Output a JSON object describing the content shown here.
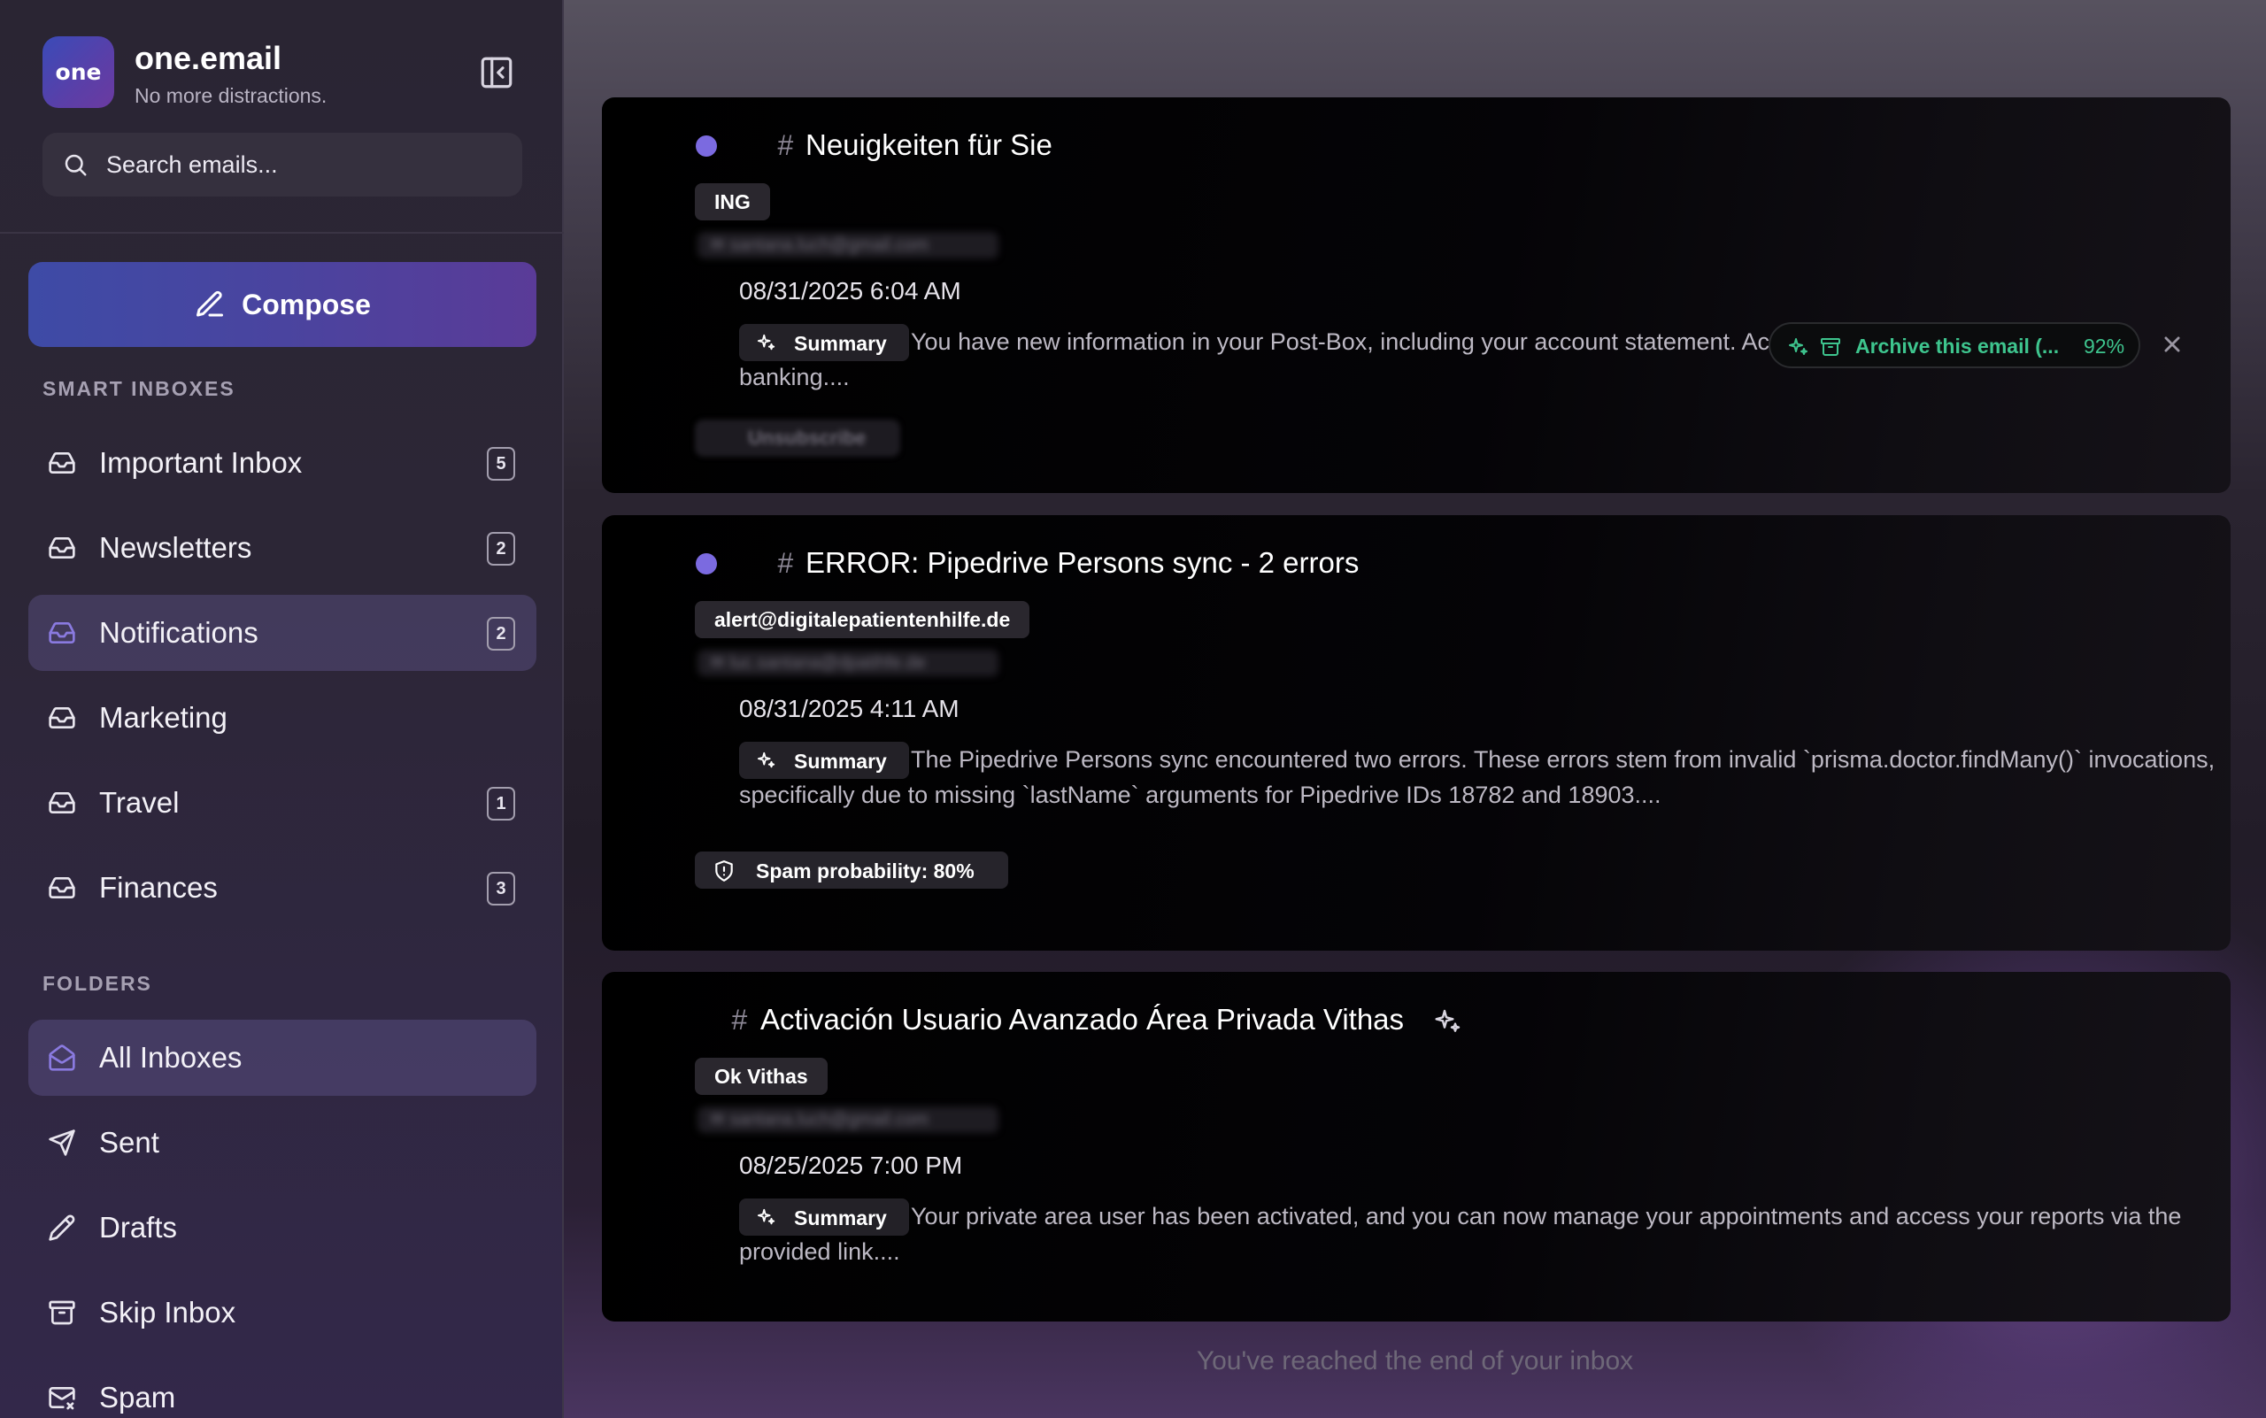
{
  "app": {
    "name": "one.email",
    "tagline": "No more distractions.",
    "logo_text": "one"
  },
  "search": {
    "placeholder": "Search emails..."
  },
  "compose": {
    "label": "Compose"
  },
  "smart_inboxes": {
    "heading": "SMART INBOXES",
    "items": [
      {
        "label": "Important Inbox",
        "count": "5",
        "icon": "inbox-icon"
      },
      {
        "label": "Newsletters",
        "count": "2",
        "icon": "inbox-icon"
      },
      {
        "label": "Notifications",
        "count": "2",
        "icon": "inbox-icon",
        "active": true
      },
      {
        "label": "Marketing",
        "count": "",
        "icon": "inbox-icon"
      },
      {
        "label": "Travel",
        "count": "1",
        "icon": "inbox-icon"
      },
      {
        "label": "Finances",
        "count": "3",
        "icon": "inbox-icon"
      }
    ]
  },
  "folders": {
    "heading": "FOLDERS",
    "items": [
      {
        "label": "All Inboxes",
        "icon": "open-mail-icon",
        "active": true
      },
      {
        "label": "Sent",
        "icon": "send-icon"
      },
      {
        "label": "Drafts",
        "icon": "pencil-icon"
      },
      {
        "label": "Skip Inbox",
        "icon": "archive-icon"
      },
      {
        "label": "Spam",
        "icon": "mail-x-icon"
      }
    ]
  },
  "emails": [
    {
      "unread": true,
      "subject": "Neuigkeiten für Sie",
      "sender": "ING",
      "recipient_blurred": "✉ santana.luch@gmail.com",
      "date": "08/31/2025 6:04 AM",
      "summary_label": "Summary",
      "summary": "You have new information in your Post-Box, including your account statement. Access it via the ING app or internet banking....",
      "unsubscribe_label": "Unsubscribe",
      "suggestion": {
        "label": "Archive this email (...",
        "confidence": "92%"
      }
    },
    {
      "unread": true,
      "subject": "ERROR: Pipedrive Persons sync - 2 errors",
      "sender": "alert@digitalepatientenhilfe.de",
      "recipient_blurred": "✉ luc.santana@dpatihfe.de",
      "date": "08/31/2025 4:11 AM",
      "summary_label": "Summary",
      "summary": "The Pipedrive Persons sync encountered two errors. These errors stem from invalid `prisma.doctor.findMany()` invocations, specifically due to missing `lastName` arguments for Pipedrive IDs 18782 and 18903....",
      "spam_label": "Spam probability: 80%"
    },
    {
      "unread": false,
      "subject": "Activación Usuario Avanzado Área Privada Vithas",
      "sender": "Ok Vithas",
      "recipient_blurred": "✉ santana.luch@gmail.com",
      "date": "08/25/2025 7:00 PM",
      "summary_label": "Summary",
      "summary": "Your private area user has been activated, and you can now manage your appointments and access your reports via the provided link...."
    }
  ],
  "footer": {
    "end_text": "You've reached the end of your inbox"
  },
  "colors": {
    "accent": "#7b6ae0",
    "suggestion_green": "#3ec58e",
    "compose_start": "#3e4ba6",
    "compose_end": "#5a3b98"
  }
}
